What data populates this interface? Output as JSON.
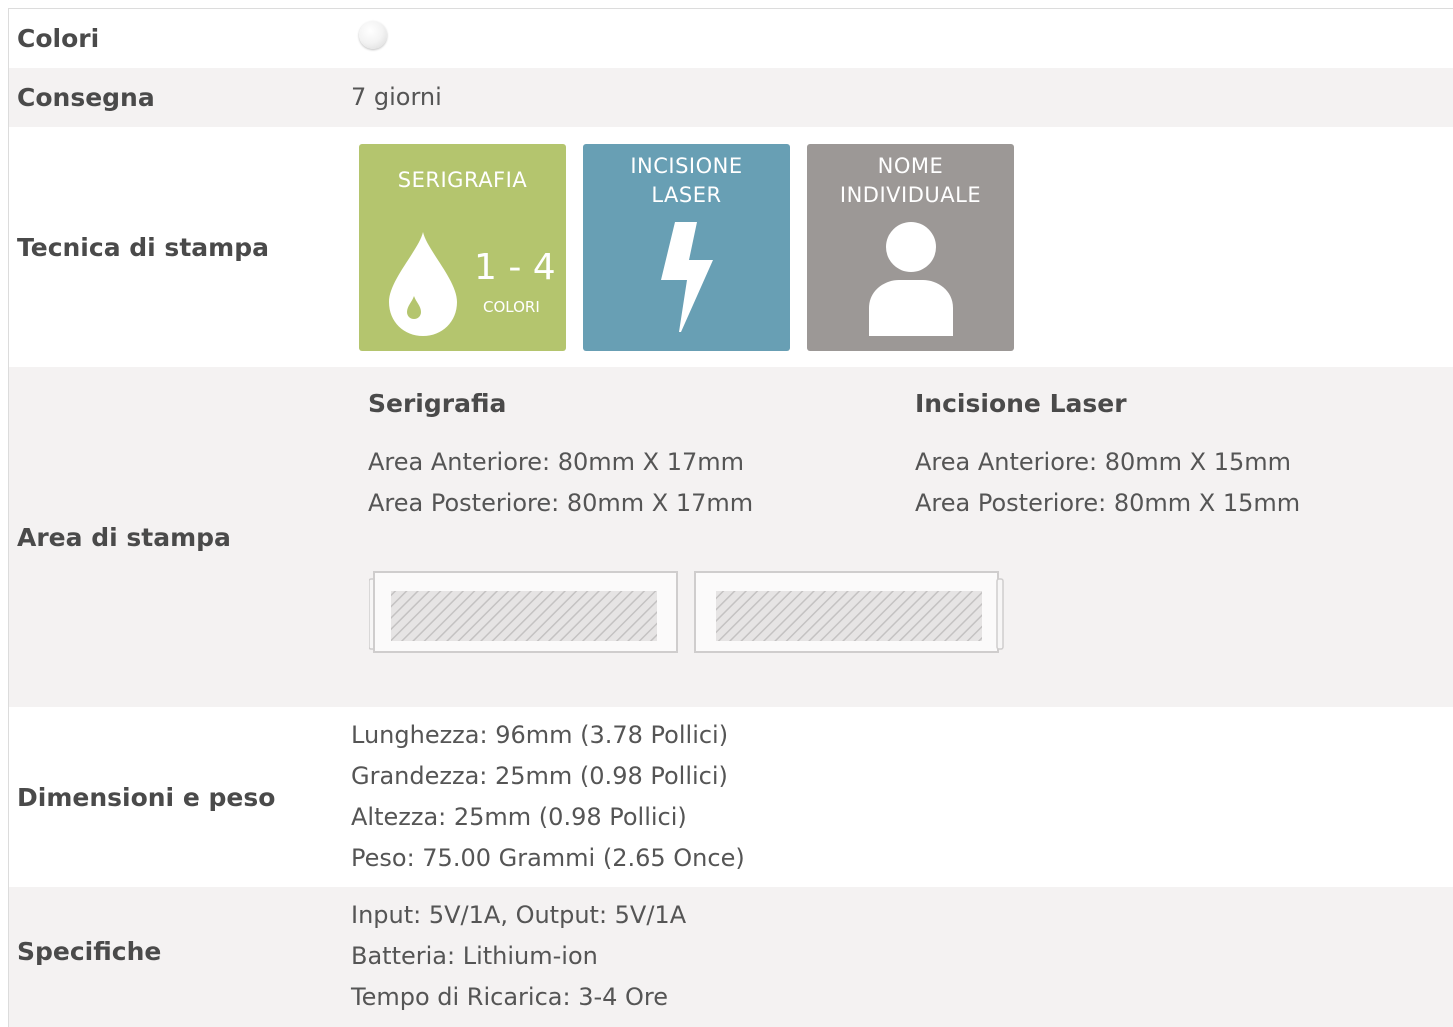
{
  "rows": {
    "colori": {
      "label": "Colori",
      "swatch_color": "#f5f5f5"
    },
    "consegna": {
      "label": "Consegna",
      "value": "7 giorni"
    },
    "tecnica": {
      "label": "Tecnica di stampa",
      "tiles": [
        {
          "title": "SERIGRAFIA",
          "count": "1 - 4",
          "count_unit": "COLORI",
          "icon": "ink-drop-icon",
          "color": "#b4c56e"
        },
        {
          "title_line1": "INCISIONE",
          "title_line2": "LASER",
          "icon": "lightning-icon",
          "color": "#689fb4"
        },
        {
          "title_line1": "NOME",
          "title_line2": "INDIVIDUALE",
          "icon": "person-icon",
          "color": "#9c9896"
        }
      ]
    },
    "area": {
      "label": "Area di stampa",
      "columns": [
        {
          "heading": "Serigrafia",
          "lines": [
            "Area Anteriore: 80mm X 17mm",
            "Area Posteriore: 80mm X 17mm"
          ]
        },
        {
          "heading": "Incisione Laser",
          "lines": [
            "Area Anteriore: 80mm X 15mm",
            "Area Posteriore: 80mm X 15mm"
          ]
        }
      ]
    },
    "dimensioni": {
      "label": "Dimensioni e peso",
      "lines": [
        "Lunghezza: 96mm (3.78 Pollici)",
        "Grandezza: 25mm (0.98 Pollici)",
        "Altezza: 25mm (0.98 Pollici)",
        "Peso: 75.00 Grammi (2.65 Once)"
      ]
    },
    "specifiche": {
      "label": "Specifiche",
      "lines": [
        "Input: 5V/1A, Output: 5V/1A",
        "Batteria: Lithium-ion",
        "Tempo di Ricarica: 3-4 Ore"
      ]
    }
  },
  "colors": {
    "row_alt_bg": "#f4f2f2",
    "label_text": "#4a4a4a",
    "value_text": "#555555"
  }
}
